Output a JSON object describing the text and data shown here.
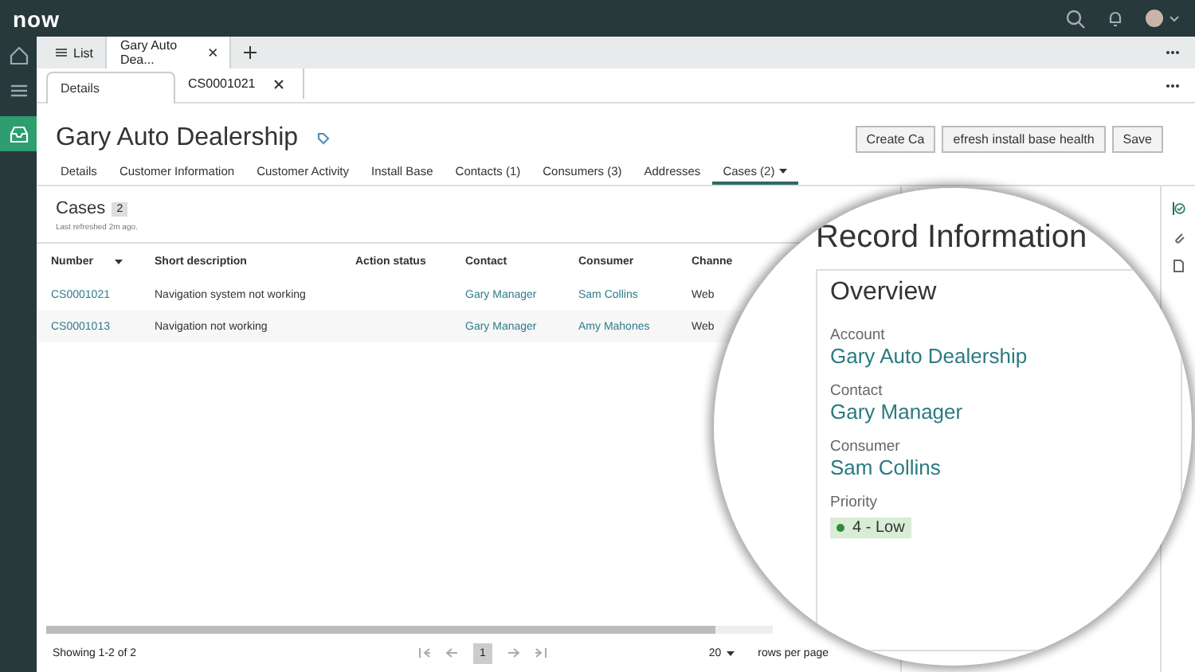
{
  "app": {
    "logo": "now"
  },
  "workspace_tabs": [
    {
      "label": "List",
      "selected": false,
      "kind": "list"
    },
    {
      "label": "Gary Auto Dea...",
      "selected": true,
      "kind": "record"
    }
  ],
  "record_tabs": [
    {
      "label": "Details",
      "selected": true,
      "closable": false
    },
    {
      "label": "CS0001021",
      "selected": false,
      "closable": true
    }
  ],
  "record": {
    "title": "Gary Auto Dealership"
  },
  "actions": [
    {
      "label": "Create Ca"
    },
    {
      "label": "efresh install base health"
    },
    {
      "label": "Save"
    }
  ],
  "nav_tabs": [
    {
      "label": "Details",
      "selected": false,
      "dropdown": false
    },
    {
      "label": "Customer Information",
      "selected": false,
      "dropdown": false
    },
    {
      "label": "Customer Activity",
      "selected": false,
      "dropdown": false
    },
    {
      "label": "Install Base",
      "selected": false,
      "dropdown": false
    },
    {
      "label": "Contacts (1)",
      "selected": false,
      "dropdown": false
    },
    {
      "label": "Consumers (3)",
      "selected": false,
      "dropdown": false
    },
    {
      "label": "Addresses",
      "selected": false,
      "dropdown": false
    },
    {
      "label": "Cases (2)",
      "selected": true,
      "dropdown": true
    }
  ],
  "cases": {
    "title": "Cases",
    "count": "2",
    "refreshed": "Last refreshed 2m ago.",
    "columns": [
      {
        "label": "Number",
        "sorted": true
      },
      {
        "label": "Short description",
        "sorted": false
      },
      {
        "label": "Action status",
        "sorted": false
      },
      {
        "label": "Contact",
        "sorted": false
      },
      {
        "label": "Consumer",
        "sorted": false
      },
      {
        "label": "Channe",
        "sorted": false
      }
    ],
    "rows": [
      {
        "number": "CS0001021",
        "short_description": "Navigation system not working",
        "contact": "Gary Manager",
        "consumer": "Sam Collins",
        "channel": "Web"
      },
      {
        "number": "CS0001013",
        "short_description": "Navigation not working",
        "contact": "Gary Manager",
        "consumer": "Amy Mahones",
        "channel": "Web"
      }
    ]
  },
  "pagination": {
    "showing": "Showing 1-2 of 2",
    "page": "1",
    "page_size": "20",
    "rows_per_page": "rows per page"
  },
  "record_information": {
    "title": "Record Information",
    "card_title": "Overview",
    "fields": [
      {
        "label": "Account",
        "value": "Gary Auto Dealership",
        "kind": "link"
      },
      {
        "label": "Contact",
        "value": "Gary Manager",
        "kind": "link"
      },
      {
        "label": "Consumer",
        "value": "Sam Collins",
        "kind": "link"
      },
      {
        "label": "Priority",
        "value": "4 - Low",
        "kind": "badge",
        "color": "#2e8b3a"
      }
    ]
  }
}
